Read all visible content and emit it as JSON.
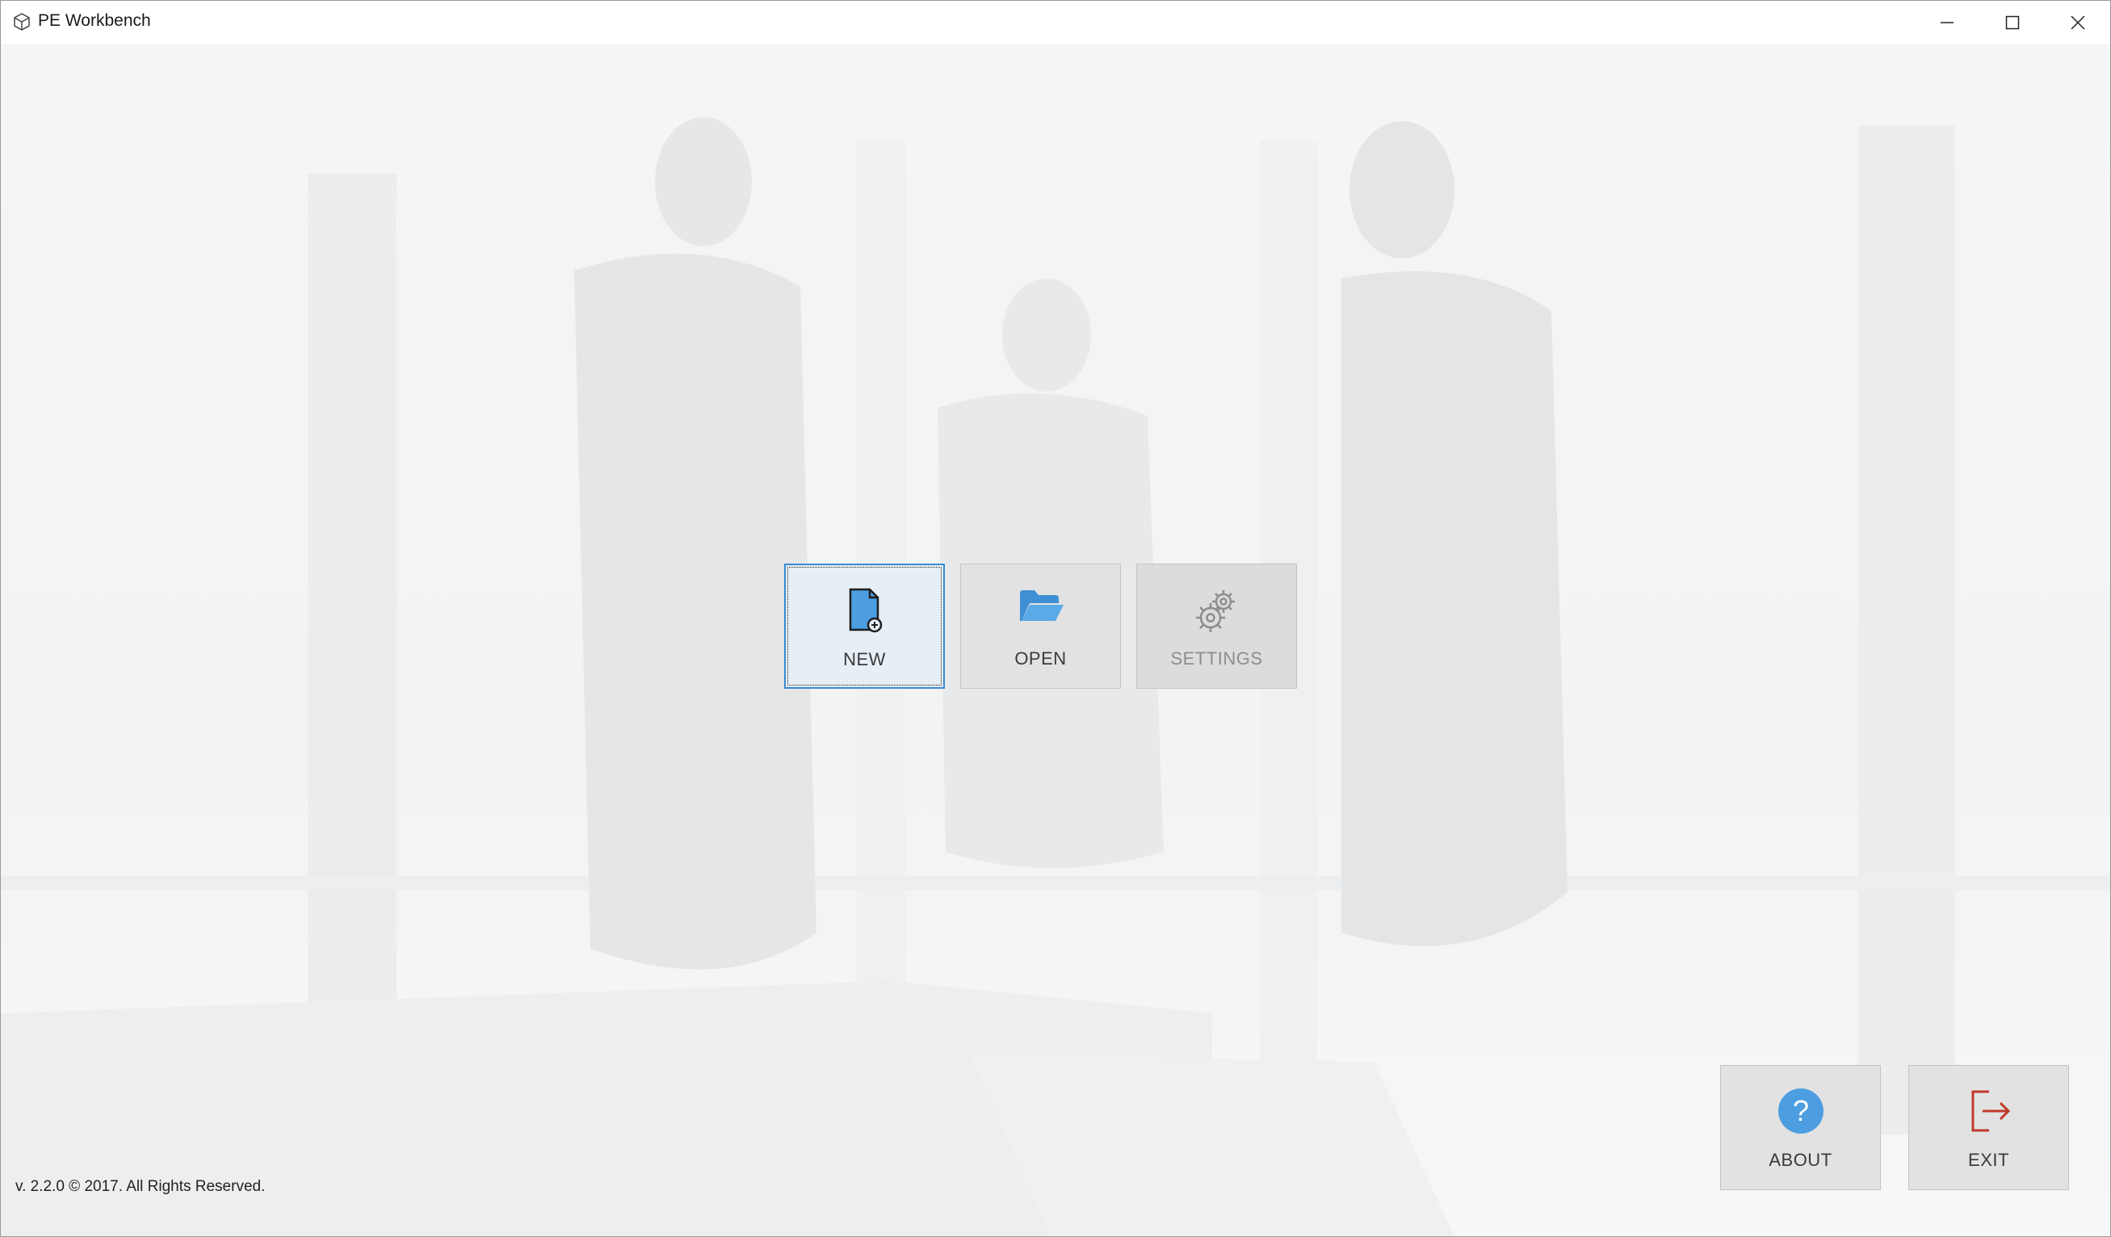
{
  "window": {
    "title": "PE Workbench",
    "icon": "cube-icon"
  },
  "main_actions": [
    {
      "label": "NEW",
      "icon": "new-document-icon",
      "enabled": true,
      "focused": true
    },
    {
      "label": "OPEN",
      "icon": "folder-open-icon",
      "enabled": true,
      "focused": false
    },
    {
      "label": "SETTINGS",
      "icon": "gears-icon",
      "enabled": false,
      "focused": false
    }
  ],
  "bottom_actions": [
    {
      "label": "ABOUT",
      "icon": "help-icon"
    },
    {
      "label": "EXIT",
      "icon": "exit-icon"
    }
  ],
  "footer": {
    "version_text": "v. 2.2.0 © 2017. All Rights Reserved."
  },
  "colors": {
    "accent": "#3a8ad0",
    "icon_blue": "#4d9ee0",
    "exit_red": "#c0392b",
    "tile_bg": "#e2e2e3"
  }
}
